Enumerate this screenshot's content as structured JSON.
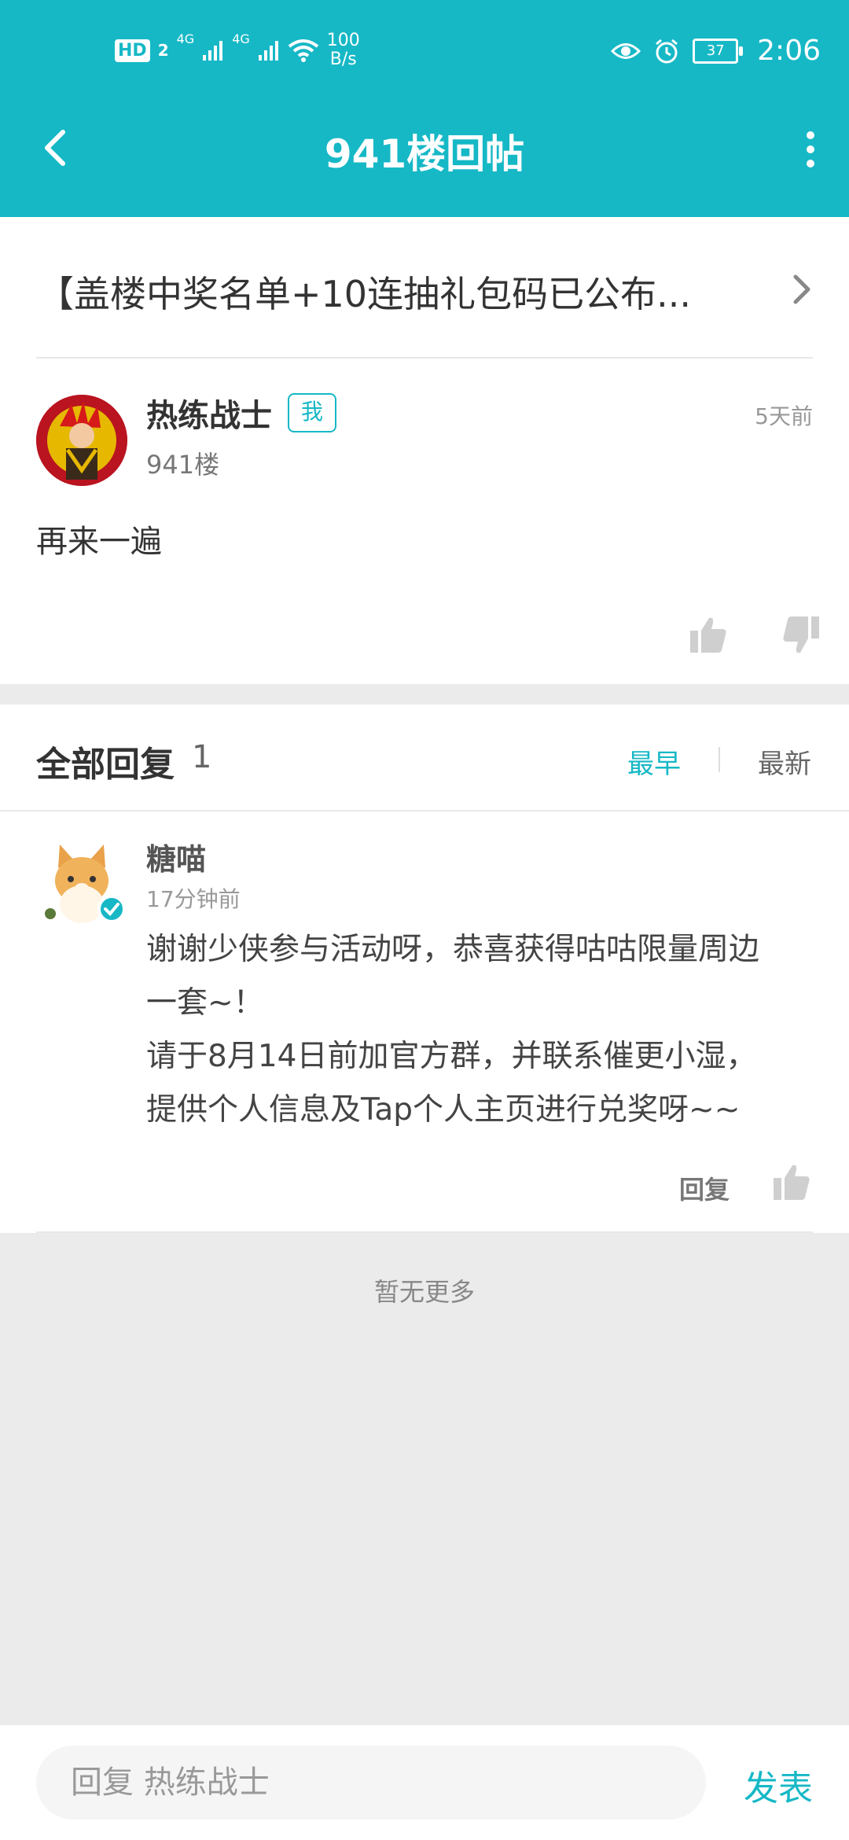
{
  "status_bar": {
    "hd": "HD",
    "hd_sub": "2",
    "net1": "4G",
    "net2": "4G",
    "speed_value": "100",
    "speed_unit": "B/s",
    "battery": "37",
    "time": "2:06"
  },
  "header": {
    "title": "941楼回帖",
    "color": "#16b8c6"
  },
  "topic": {
    "title": "【盖楼中奖名单+10连抽礼包码已公布..."
  },
  "post": {
    "author": "热练战士",
    "me_badge": "我",
    "floor": "941楼",
    "time": "5天前",
    "content": "再来一遍"
  },
  "replies": {
    "heading": "全部回复",
    "count": "1",
    "sort_earliest": "最早",
    "sort_newest": "最新",
    "items": [
      {
        "author": "糖喵",
        "time": "17分钟前",
        "lines": [
          "谢谢少侠参与活动呀，恭喜获得咕咕限量周边",
          "一套~！",
          "请于8月14日前加官方群，并联系催更小湿，",
          "提供个人信息及Tap个人主页进行兑奖呀~~"
        ],
        "reply_label": "回复"
      }
    ]
  },
  "footer_note": "暂无更多",
  "bottom_bar": {
    "placeholder": "回复 热练战士",
    "send_label": "发表"
  }
}
